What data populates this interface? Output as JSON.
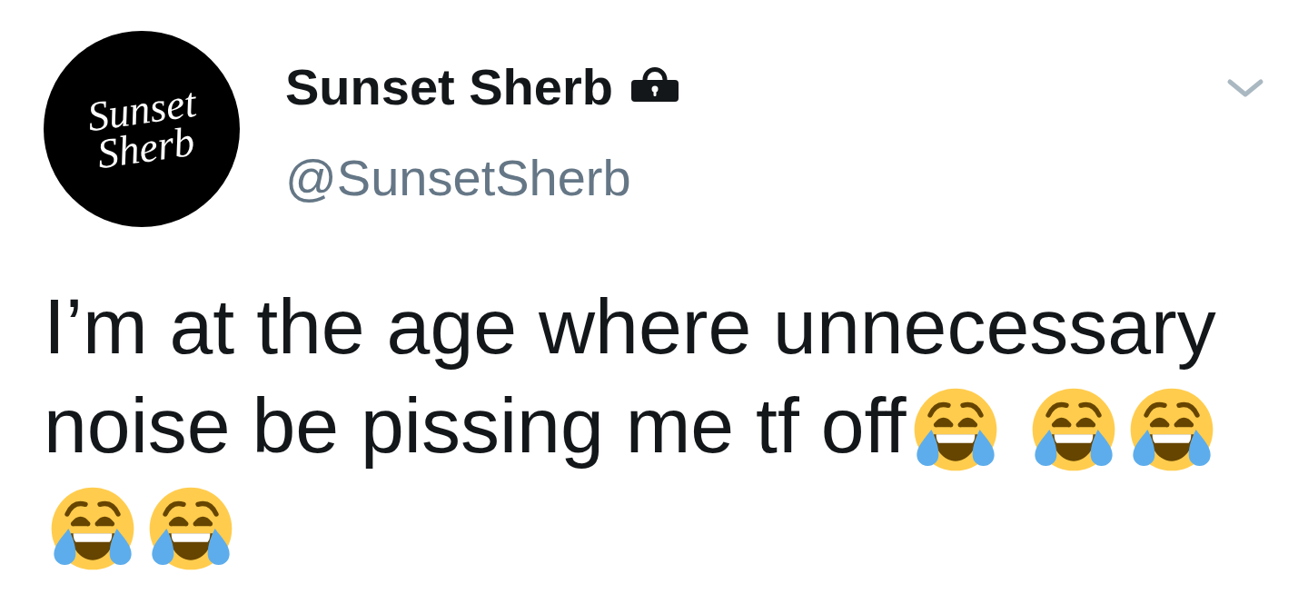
{
  "author": {
    "avatar": {
      "logo_lines": [
        "Sunset",
        "Sherb"
      ]
    },
    "name": "Sunset Sherb",
    "protected": true,
    "handle": "@SunsetSherb"
  },
  "tweet": {
    "text_lines": [
      "I’m at the age where unnecessary",
      "noise be pissing me tf off"
    ],
    "trailing": [
      {
        "kind": "emoji"
      },
      {
        "kind": "space"
      },
      {
        "kind": "emoji"
      },
      {
        "kind": "emoji"
      },
      {
        "kind": "emoji"
      },
      {
        "kind": "emoji"
      }
    ]
  }
}
